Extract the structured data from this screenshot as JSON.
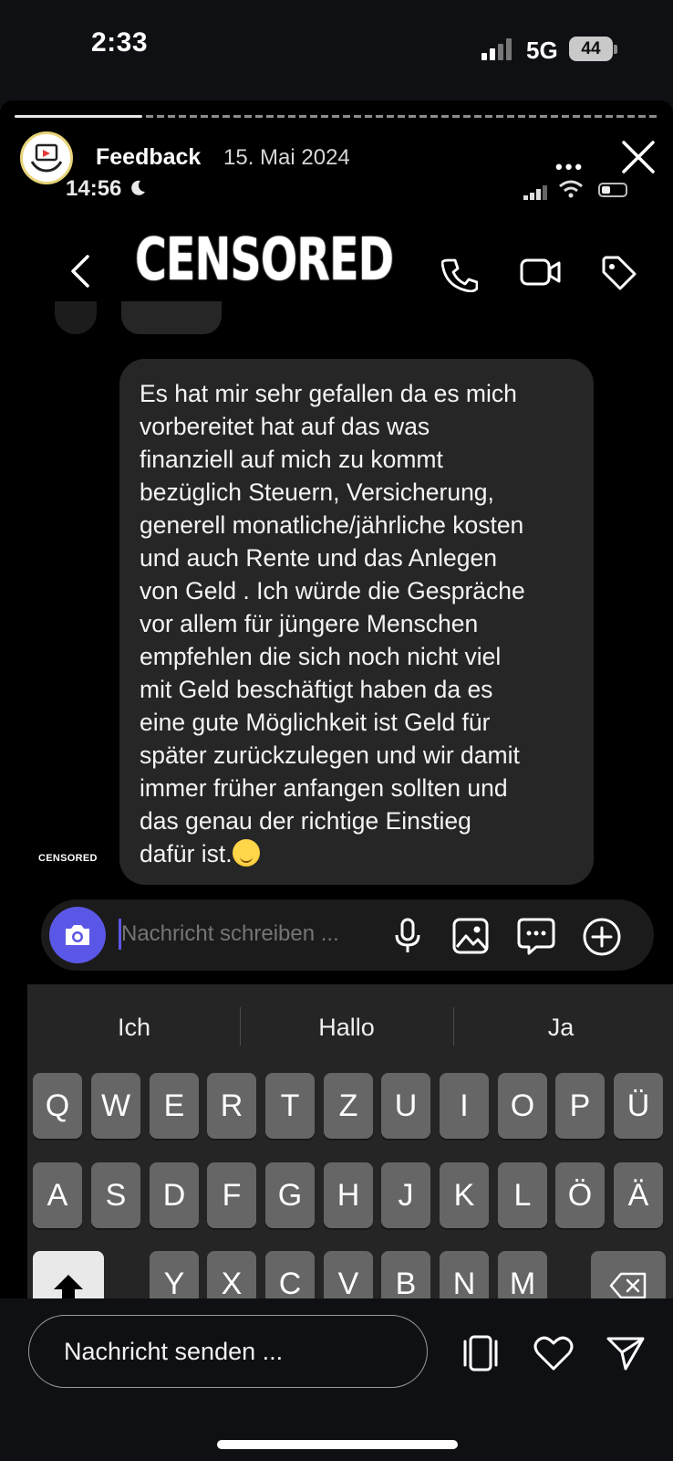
{
  "status_bar": {
    "time": "2:33",
    "network": "5G",
    "battery": "44"
  },
  "story": {
    "title": "Feedback",
    "date": "15. Mai 2024",
    "more_label": "•••",
    "progress": 0.2
  },
  "inner_screen": {
    "time": "14:56",
    "chat_title": "CENSORED",
    "watermark": "CENSORED",
    "message": "Es hat mir sehr gefallen da es mich\nvorbereitet hat auf das was\nfinanziell auf mich zu kommt\nbezüglich Steuern, Versicherung,\ngenerell monatliche/jährliche kosten\nund auch Rente und das Anlegen\nvon Geld . Ich würde die Gespräche\nvor allem für jüngere Menschen\nempfehlen die sich noch nicht viel\nmit Geld beschäftigt haben da es\neine gute Möglichkeit ist Geld für\nspäter zurückzulegen und wir damit\nimmer früher anfangen sollten und\ndas genau der richtige Einstieg\ndafür ist.",
    "composer_placeholder": "Nachricht schreiben ...",
    "keyboard": {
      "suggestions": [
        "Ich",
        "Hallo",
        "Ja"
      ],
      "row1": [
        "Q",
        "W",
        "E",
        "R",
        "T",
        "Z",
        "U",
        "I",
        "O",
        "P",
        "Ü"
      ],
      "row2": [
        "A",
        "S",
        "D",
        "F",
        "G",
        "H",
        "J",
        "K",
        "L",
        "Ö",
        "Ä"
      ],
      "row3": [
        "Y",
        "X",
        "C",
        "V",
        "B",
        "N",
        "M"
      ]
    }
  },
  "reply": {
    "placeholder": "Nachricht senden ..."
  }
}
